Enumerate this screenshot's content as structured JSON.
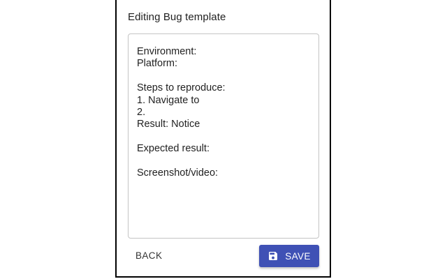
{
  "dialog": {
    "title": "Editing Bug template"
  },
  "editor": {
    "lines": [
      "Environment:",
      "Platform:",
      "",
      "Steps to reproduce:",
      "1. Navigate to",
      "2.",
      "Result: Notice",
      "",
      "Expected result:",
      "",
      "Screenshot/video:"
    ]
  },
  "actions": {
    "back_label": "BACK",
    "save_label": "SAVE",
    "save_icon": "floppy-disk-icon"
  },
  "colors": {
    "primary": "#3f51b5",
    "border": "#c4c4c4",
    "frame": "#000000"
  }
}
